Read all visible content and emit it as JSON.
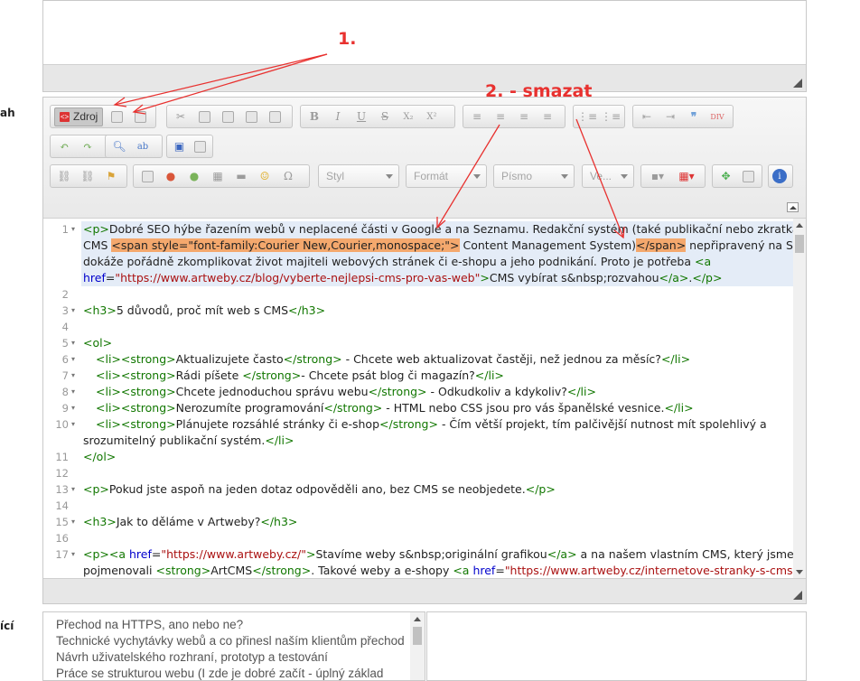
{
  "labels": {
    "left_ah": "ah",
    "left_ici": "ící"
  },
  "annotations": {
    "one": "1.",
    "two": "2. - smazat",
    "color": "#e8312f"
  },
  "toolbar": {
    "source_label": "Zdroj",
    "style_placeholder": "Styl",
    "format_placeholder": "Formát",
    "font_placeholder": "Písmo",
    "size_placeholder": "Ve..."
  },
  "code_lines": [
    {
      "n": "1",
      "fold": "▾"
    },
    {
      "n": "",
      "fold": ""
    },
    {
      "n": "",
      "fold": ""
    },
    {
      "n": "",
      "fold": ""
    },
    {
      "n": "2",
      "fold": ""
    },
    {
      "n": "3",
      "fold": "▾"
    },
    {
      "n": "4",
      "fold": ""
    },
    {
      "n": "5",
      "fold": "▾"
    },
    {
      "n": "6",
      "fold": "▾"
    },
    {
      "n": "7",
      "fold": "▾"
    },
    {
      "n": "8",
      "fold": "▾"
    },
    {
      "n": "9",
      "fold": "▾"
    },
    {
      "n": "10",
      "fold": "▾"
    },
    {
      "n": "",
      "fold": ""
    },
    {
      "n": "11",
      "fold": ""
    },
    {
      "n": "12",
      "fold": ""
    },
    {
      "n": "13",
      "fold": "▾"
    },
    {
      "n": "14",
      "fold": ""
    },
    {
      "n": "15",
      "fold": "▾"
    },
    {
      "n": "16",
      "fold": ""
    },
    {
      "n": "17",
      "fold": "▾"
    },
    {
      "n": "",
      "fold": ""
    }
  ],
  "code": {
    "l1a": "Dobré SEO hýbe řazením webů v neplacené části v Google a na Seznamu. Redakční systém (také publikační nebo zkratka",
    "l1b_pre": "CMS ",
    "l1b_span": "<span style=\"font-family:Courier New,Courier,monospace;\">",
    "l1b_mid": " Content Management System)",
    "l1b_close": "</span>",
    "l1b_post": " nepřipravený na SEO",
    "l1c_pre": "dokáže pořádně zkomplikovat život majiteli webových stránek či e-shopu a jeho podnikání. Proto je potřeba ",
    "l1d_href": "\"https://www.artweby.cz/blog/vyberte-nejlepsi-cms-pro-vas-web\"",
    "l1d_text": "CMS vybírat s&nbsp;rozvahou",
    "l1d_post": ".",
    "h3_1": "5 důvodů, proč mít web s CMS",
    "li1_strong": "Aktualizujete často",
    "li1_rest": " - Chcete web aktualizovat častěji, než jednou za měsíc?",
    "li2_strong": "Rádi píšete ",
    "li2_rest": "- Chcete psát blog či magazín?",
    "li3_strong": "Chcete jednoduchou správu webu",
    "li3_rest": " - Odkudkoliv a kdykoliv?",
    "li4_strong": "Nerozumíte programování",
    "li4_rest": " - HTML nebo CSS jsou pro vás španělské vesnice.",
    "li5_strong": "Plánujete rozsáhlé stránky či e-shop",
    "li5_rest": " - Čím větší projekt, tím palčivější nutnost mít spolehlivý a",
    "li5_cont": "srozumitelný publikační systém.",
    "p13": "Pokud jste aspoň na jeden dotaz odpověděli ano, bez CMS se neobjedete.",
    "h3_2": "Jak to děláme v Artweby?",
    "l17_href": "\"https://www.artweby.cz/\"",
    "l17_link": "Stavíme weby s&nbsp;originální grafikou",
    "l17_rest": " a na našem vlastním CMS, který jsme",
    "l17b_pre": "pojmenovali ",
    "l17b_strong": "ArtCMS",
    "l17b_mid": ". Takové weby a e-shopy ",
    "l17b_href": "\"https://www.artweby.cz/internetove-stranky-s-cms-"
  },
  "related_list": [
    "Přechod na HTTPS, ano nebo ne?",
    "Technické vychytávky webů a co přinesl naším klientům přechod",
    "Návrh uživatelského rozhraní, prototyp a testování",
    "Práce se strukturou webu (I zde je dobré začít - úplný základ"
  ]
}
